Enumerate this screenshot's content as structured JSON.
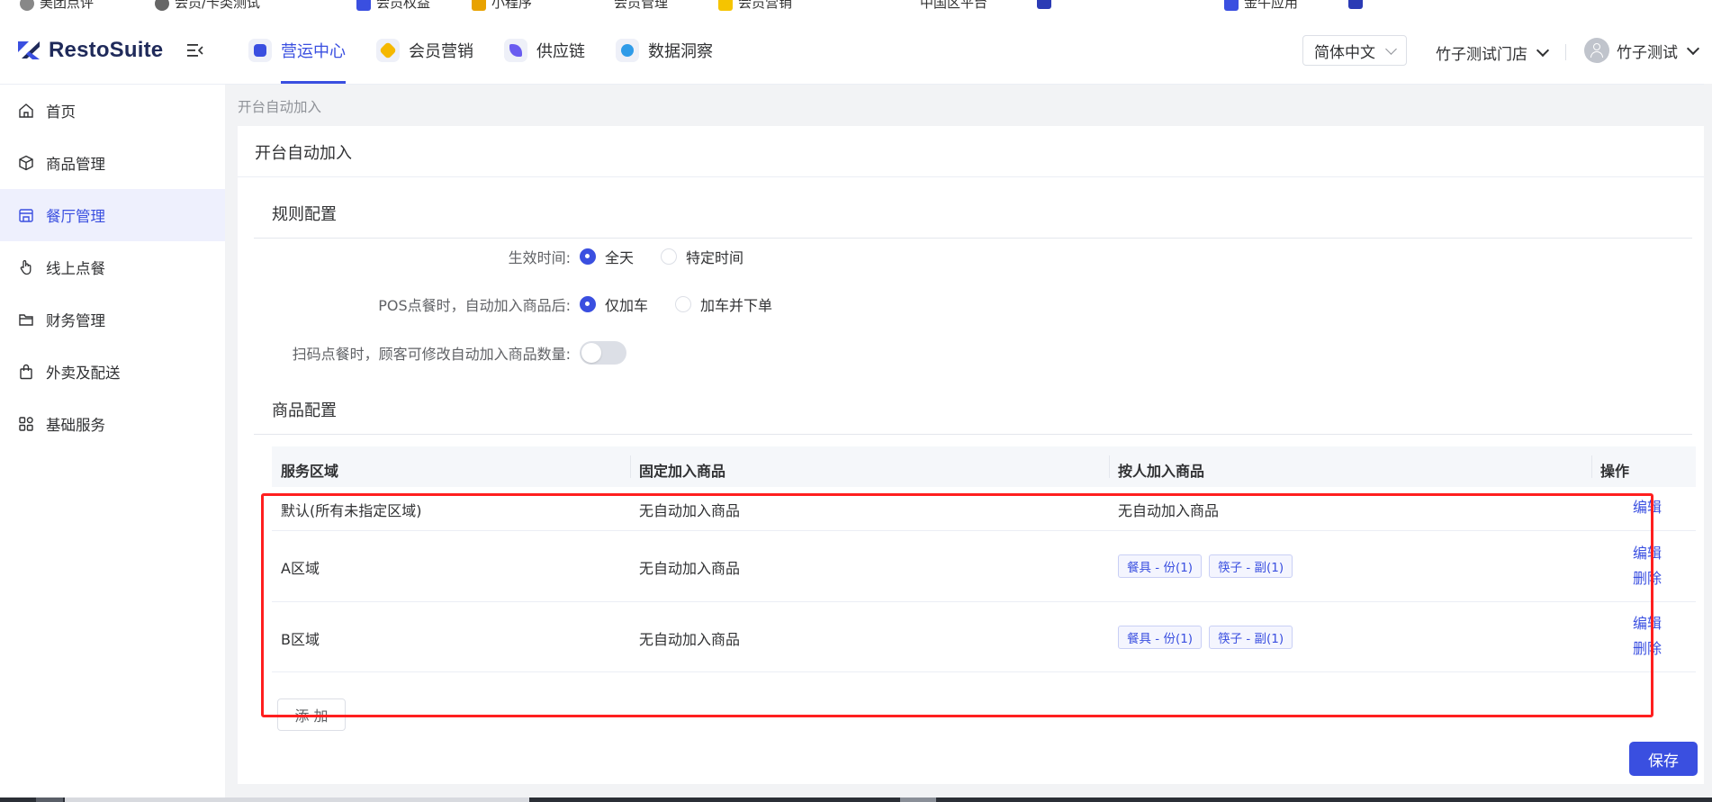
{
  "browser": {
    "bookmarks": [
      "美团点评",
      "会员/卡类测试",
      "会员权益",
      "小程序",
      "会员管理",
      "会员营销",
      "中国区平台",
      "",
      "金牛应用"
    ]
  },
  "topnav": {
    "logo_text": "RestoSuite",
    "modules": [
      {
        "label": "营运中心",
        "active": true,
        "color": "#3a4fe0"
      },
      {
        "label": "会员营销",
        "active": false,
        "color": "#f5b800"
      },
      {
        "label": "供应链",
        "active": false,
        "color": "#6a5cf0"
      },
      {
        "label": "数据洞察",
        "active": false,
        "color": "#2f9be8"
      }
    ],
    "language": "简体中文",
    "store": "竹子测试门店",
    "user": "竹子测试"
  },
  "sidebar": {
    "items": [
      {
        "label": "首页",
        "icon": "home-icon"
      },
      {
        "label": "商品管理",
        "icon": "box-icon"
      },
      {
        "label": "餐厅管理",
        "icon": "store-icon",
        "active": true
      },
      {
        "label": "线上点餐",
        "icon": "hand-pointer-icon"
      },
      {
        "label": "财务管理",
        "icon": "folder-icon"
      },
      {
        "label": "外卖及配送",
        "icon": "bag-icon"
      },
      {
        "label": "基础服务",
        "icon": "grid-icon"
      }
    ]
  },
  "breadcrumb": "开台自动加入",
  "page_title": "开台自动加入",
  "rules": {
    "section_title": "规则配置",
    "effective_time": {
      "label": "生效时间:",
      "options": [
        "全天",
        "特定时间"
      ],
      "selected": "全天"
    },
    "pos_after_add": {
      "label": "POS点餐时，自动加入商品后:",
      "options": [
        "仅加车",
        "加车并下单"
      ],
      "selected": "仅加车"
    },
    "scan_modify_qty": {
      "label": "扫码点餐时，顾客可修改自动加入商品数量:",
      "enabled": false
    }
  },
  "products": {
    "section_title": "商品配置",
    "columns": [
      "服务区域",
      "固定加入商品",
      "按人加入商品",
      "操作"
    ],
    "rows": [
      {
        "area": "默认(所有未指定区域)",
        "fixed": "无自动加入商品",
        "per_person_text": "无自动加入商品",
        "per_person_tags": [],
        "actions": [
          "编辑"
        ]
      },
      {
        "area": "A区域",
        "fixed": "无自动加入商品",
        "per_person_text": "",
        "per_person_tags": [
          "餐具 - 份(1)",
          "筷子 - 副(1)"
        ],
        "actions": [
          "编辑",
          "删除"
        ]
      },
      {
        "area": "B区域",
        "fixed": "无自动加入商品",
        "per_person_text": "",
        "per_person_tags": [
          "餐具 - 份(1)",
          "筷子 - 副(1)"
        ],
        "actions": [
          "编辑",
          "删除"
        ]
      }
    ],
    "add_label": "添 加"
  },
  "save_label": "保存"
}
